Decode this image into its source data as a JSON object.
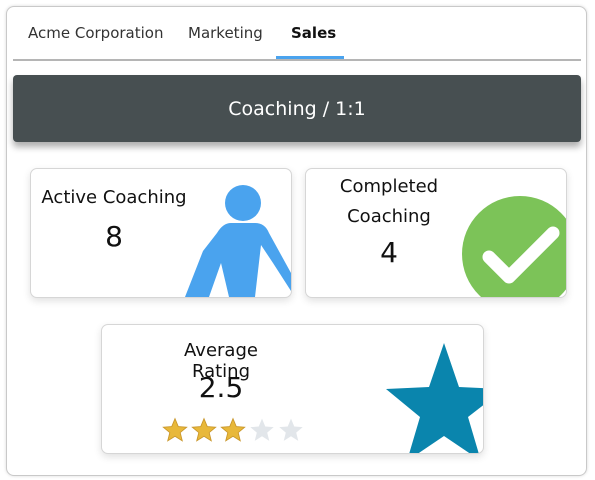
{
  "tabs": [
    {
      "label": "Acme Corporation",
      "active": false
    },
    {
      "label": "Marketing",
      "active": false
    },
    {
      "label": "Sales",
      "active": true
    }
  ],
  "banner": {
    "title": "Coaching / 1:1"
  },
  "cards": {
    "active_coaching": {
      "label": "Active Coaching",
      "value": "8",
      "icon": "person-walking-icon"
    },
    "completed_coaching": {
      "label_line1": "Completed",
      "label_line2": "Coaching",
      "value": "4",
      "icon": "checkmark-icon"
    },
    "average_rating": {
      "label": "Average Rating",
      "value": "2.5",
      "rating": 2.5,
      "max_rating": 5,
      "icon": "star-icon"
    }
  },
  "colors": {
    "accent_tab": "#4aa3ee",
    "banner": "#474f51",
    "person": "#4aa3ee",
    "check_bg": "#7cc358",
    "star_big": "#0a85ad",
    "star_gold": "#e8b83a",
    "star_empty": "#e2e6ea"
  }
}
